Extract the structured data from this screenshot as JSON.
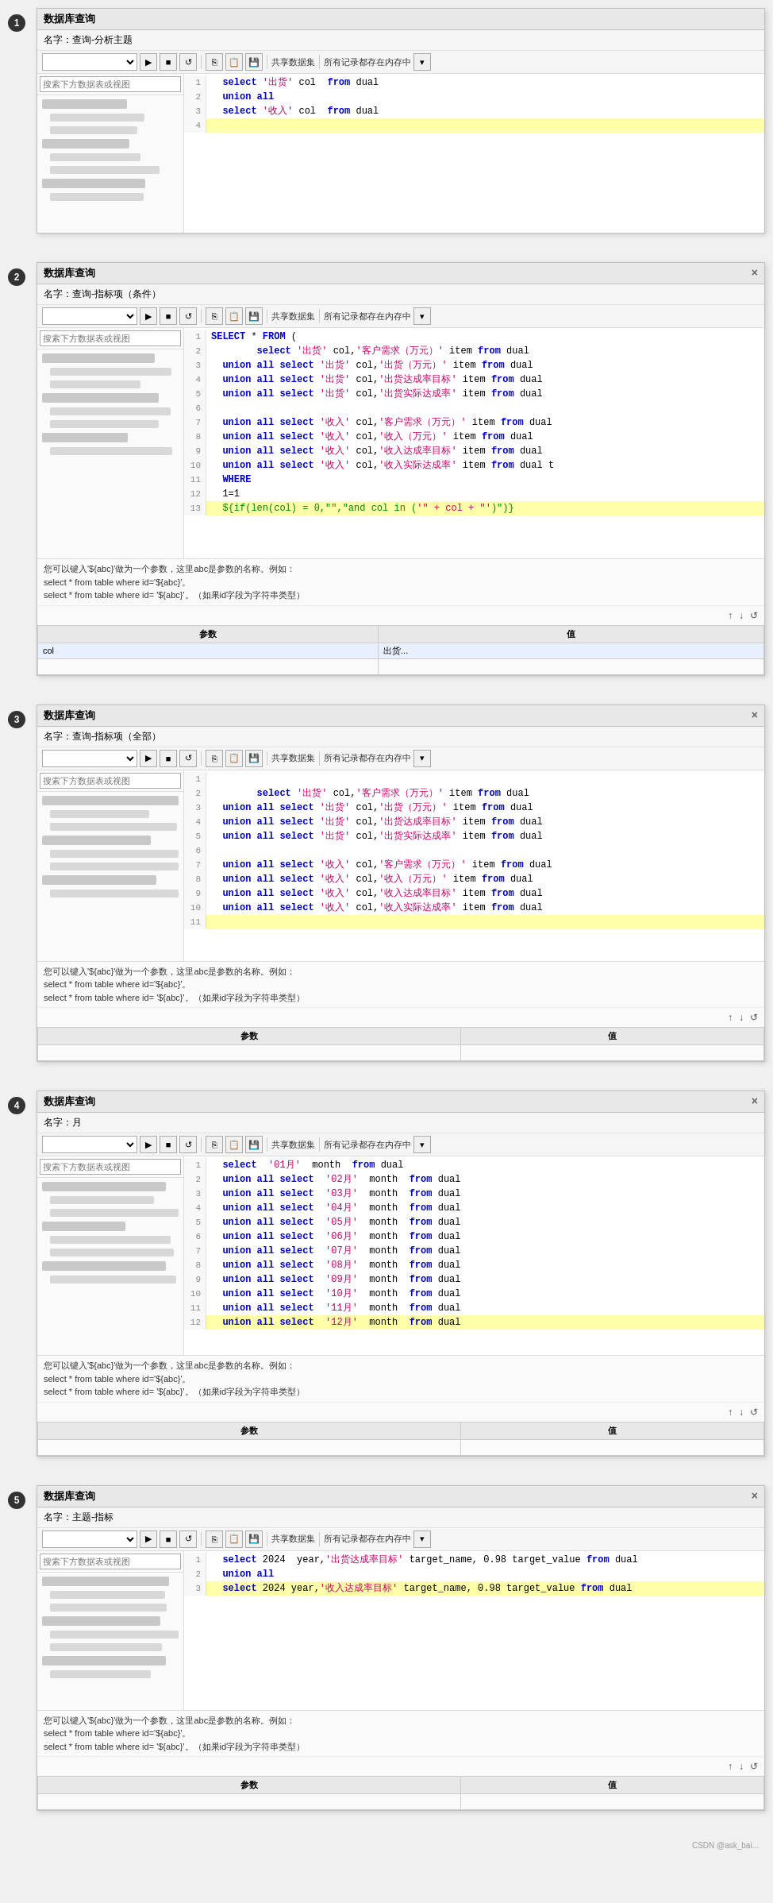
{
  "watermark": "CSDN @ask_bai...",
  "panels": [
    {
      "id": "panel1",
      "badge": "1",
      "title": "数据库查询",
      "name_label": "名字：查询-分析主题",
      "has_close": false,
      "toolbar": {
        "select_value": "",
        "shared_label": "共享数据集",
        "memory_label": "所有记录都存在内存中"
      },
      "left_search_placeholder": "搜索下方数据表或视图",
      "code_lines": [
        {
          "num": 1,
          "text": "  select '出货' col  from dual",
          "highlight": false,
          "parts": [
            {
              "t": "  select ",
              "c": "kw-blue"
            },
            {
              "t": "'出货'",
              "c": "kw-pink"
            },
            {
              "t": " col  from dual",
              "c": "kw-black"
            }
          ]
        },
        {
          "num": 2,
          "text": "  union all",
          "highlight": false,
          "parts": [
            {
              "t": "  union all",
              "c": "kw-blue"
            }
          ]
        },
        {
          "num": 3,
          "text": "  select '收入' col  from dual",
          "highlight": false,
          "parts": [
            {
              "t": "  select ",
              "c": "kw-blue"
            },
            {
              "t": "'收入'",
              "c": "kw-pink"
            },
            {
              "t": " col  from dual",
              "c": "kw-black"
            }
          ]
        },
        {
          "num": 4,
          "text": "",
          "highlight": true,
          "parts": []
        }
      ],
      "params": [
        {
          "name": "",
          "value": ""
        }
      ],
      "hint": ""
    },
    {
      "id": "panel2",
      "badge": "2",
      "title": "数据库查询",
      "name_label": "名字：查询-指标项（条件）",
      "has_close": true,
      "toolbar": {
        "select_value": "",
        "shared_label": "共享数据集",
        "memory_label": "所有记录都存在内存中"
      },
      "left_search_placeholder": "搜索下方数据表或视图",
      "code_lines": [
        {
          "num": 1,
          "text": "SELECT * FROM (",
          "highlight": false
        },
        {
          "num": 2,
          "text": "        select '出货' col,'客户需求（万元）' item from dual",
          "highlight": false
        },
        {
          "num": 3,
          "text": "  union all select '出货' col,'出货（万元）' item from dual",
          "highlight": false
        },
        {
          "num": 4,
          "text": "  union all select '出货' col,'出货达成率目标' item from dual",
          "highlight": false
        },
        {
          "num": 5,
          "text": "  union all select '出货' col,'出货实际达成率' item from dual",
          "highlight": false
        },
        {
          "num": 6,
          "text": "",
          "highlight": false
        },
        {
          "num": 7,
          "text": "  union all select '收入' col,'客户需求（万元）' item from dual",
          "highlight": false
        },
        {
          "num": 8,
          "text": "  union all select '收入' col,'收入（万元）' item from dual",
          "highlight": false
        },
        {
          "num": 9,
          "text": "  union all select '收入' col,'收入达成率目标' item from dual",
          "highlight": false
        },
        {
          "num": 10,
          "text": "  union all select '收入' col,'收入实际达成率' item from dual t",
          "highlight": false
        },
        {
          "num": 11,
          "text": "  WHERE",
          "highlight": false
        },
        {
          "num": 12,
          "text": "  1=1",
          "highlight": false
        },
        {
          "num": 13,
          "text": "  ${if(len(col) = 0,\"\",\"and col in ('\" + col + \"')\")}",
          "highlight": true
        }
      ],
      "hint": "您可以键入'${abc}'做为一个参数，这里abc是参数的名称。例如：\nselect * from table where id='${abc}'。\nselect * from table where id= '${abc}'。（如果id字段为字符串类型）",
      "params": [
        {
          "name": "col",
          "value": "出货..."
        }
      ]
    },
    {
      "id": "panel3",
      "badge": "3",
      "title": "数据库查询",
      "name_label": "名字：查询-指标项（全部）",
      "has_close": true,
      "toolbar": {
        "select_value": "",
        "shared_label": "共享数据集",
        "memory_label": "所有记录都存在内存中"
      },
      "left_search_placeholder": "搜索下方数据表或视图",
      "code_lines": [
        {
          "num": 1,
          "text": "",
          "highlight": false
        },
        {
          "num": 2,
          "text": "        select '出货' col,'客户需求（万元）' item from dual",
          "highlight": false
        },
        {
          "num": 3,
          "text": "  union all select '出货' col,'出货（万元）' item from dual",
          "highlight": false
        },
        {
          "num": 4,
          "text": "  union all select '出货' col,'出货达成率目标' item from dual",
          "highlight": false
        },
        {
          "num": 5,
          "text": "  union all select '出货' col,'出货实际达成率' item from dual",
          "highlight": false
        },
        {
          "num": 6,
          "text": "",
          "highlight": false
        },
        {
          "num": 7,
          "text": "  union all select '收入' col,'客户需求（万元）' item from dual",
          "highlight": false
        },
        {
          "num": 8,
          "text": "  union all select '收入' col,'收入（万元）' item from dual",
          "highlight": false
        },
        {
          "num": 9,
          "text": "  union all select '收入' col,'收入达成率目标' item from dual",
          "highlight": false
        },
        {
          "num": 10,
          "text": "  union all select '收入' col,'收入实际达成率' item from dual",
          "highlight": false
        },
        {
          "num": 11,
          "text": "",
          "highlight": true
        }
      ],
      "hint": "您可以键入'${abc}'做为一个参数，这里abc是参数的名称。例如：\nselect * from table where id='${abc}'。\nselect * from table where id= '${abc}'。（如果id字段为字符串类型）",
      "params": []
    },
    {
      "id": "panel4",
      "badge": "4",
      "title": "数据库查询",
      "name_label": "名字：月",
      "has_close": true,
      "toolbar": {
        "select_value": "",
        "shared_label": "共享数据集",
        "memory_label": "所有记录都存在内存中"
      },
      "left_search_placeholder": "搜索下方数据表或视图",
      "code_lines": [
        {
          "num": 1,
          "text": "  select  '01月'  month  from dual",
          "highlight": false
        },
        {
          "num": 2,
          "text": "  union all select  '02月'  month  from dual",
          "highlight": false
        },
        {
          "num": 3,
          "text": "  union all select  '03月'  month  from dual",
          "highlight": false
        },
        {
          "num": 4,
          "text": "  union all select  '04月'  month  from dual",
          "highlight": false
        },
        {
          "num": 5,
          "text": "  union all select  '05月'  month  from dual",
          "highlight": false
        },
        {
          "num": 6,
          "text": "  union all select  '06月'  month  from dual",
          "highlight": false
        },
        {
          "num": 7,
          "text": "  union all select  '07月'  month  from dual",
          "highlight": false
        },
        {
          "num": 8,
          "text": "  union all select  '08月'  month  from dual",
          "highlight": false
        },
        {
          "num": 9,
          "text": "  union all select  '09月'  month  from dual",
          "highlight": false
        },
        {
          "num": 10,
          "text": "  union all select  '10月'  month  from dual",
          "highlight": false
        },
        {
          "num": 11,
          "text": "  union all select  '11月'  month  from dual",
          "highlight": false
        },
        {
          "num": 12,
          "text": "  union all select  '12月'  month  from dual",
          "highlight": true
        }
      ],
      "hint": "您可以键入'${abc}'做为一个参数，这里abc是参数的名称。例如：\nselect * from table where id='${abc}'。\nselect * from table where id= '${abc}'。（如果id字段为字符串类型）",
      "params": []
    },
    {
      "id": "panel5",
      "badge": "5",
      "title": "数据库查询",
      "name_label": "名字：主题-指标",
      "has_close": true,
      "toolbar": {
        "select_value": "",
        "shared_label": "共享数据集",
        "memory_label": "所有记录都存在内存中"
      },
      "left_search_placeholder": "搜索下方数据表或视图",
      "code_lines": [
        {
          "num": 1,
          "text": "  select 2024  year,'出货达成率目标' target_name, 0.98 target_value from dual",
          "highlight": false
        },
        {
          "num": 2,
          "text": "  union all",
          "highlight": false
        },
        {
          "num": 3,
          "text": "  select 2024 year,'收入达成率目标' target_name, 0.98 target_value from dual",
          "highlight": true
        }
      ],
      "hint": "您可以键入'${abc}'做为一个参数，这里abc是参数的名称。例如：\nselect * from table where id='${abc}'。\nselect * from table where id= '${abc}'。（如果id字段为字符串类型）",
      "params": []
    }
  ],
  "ui": {
    "title": "数据库查询",
    "close_icon": "×",
    "search_icon": "🔍",
    "toolbar_icons": {
      "run": "▶",
      "stop": "■",
      "refresh": "↺",
      "copy": "⎘",
      "paste": "📋",
      "save": "💾",
      "share": "⊕",
      "arrow_up": "↑",
      "arrow_down": "↓",
      "reload": "↺"
    },
    "params_col1": "参数",
    "params_col2": "值",
    "hint_template": "您可以键入'${abc}'做为一个参数，这里abc是参数的名称。例如：\nselect * from table where id='${abc}'。\nselect * from table where id= '${abc}'。（如果id字段为字符串类型）"
  }
}
